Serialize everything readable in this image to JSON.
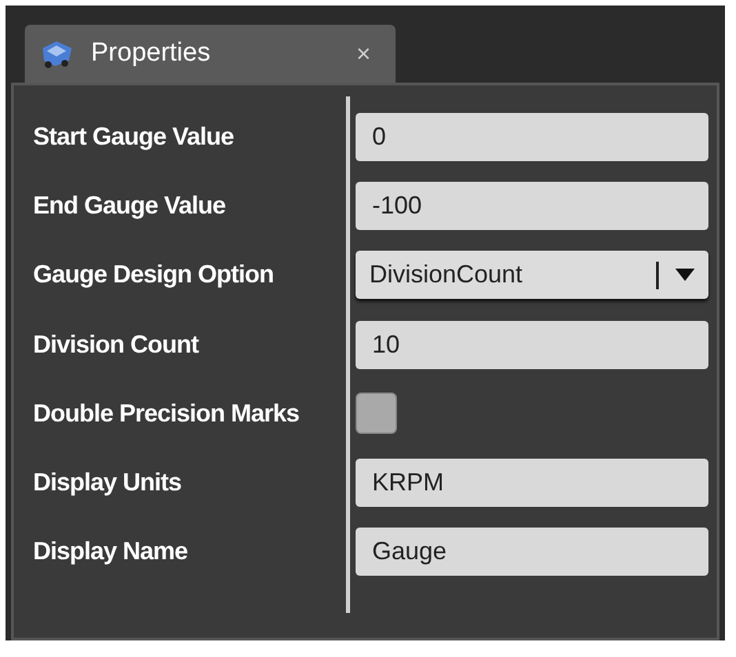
{
  "tab": {
    "title": "Properties",
    "close": "×"
  },
  "properties": [
    {
      "label": "Start Gauge Value",
      "kind": "text",
      "value": "0"
    },
    {
      "label": "End Gauge Value",
      "kind": "text",
      "value": "-100"
    },
    {
      "label": "Gauge Design Option",
      "kind": "dropdown",
      "value": "DivisionCount"
    },
    {
      "label": "Division Count",
      "kind": "text",
      "value": "10"
    },
    {
      "label": "Double Precision Marks",
      "kind": "checkbox",
      "checked": false
    },
    {
      "label": "Display Units",
      "kind": "text",
      "value": "KRPM"
    },
    {
      "label": "Display Name",
      "kind": "text",
      "value": "Gauge"
    }
  ]
}
